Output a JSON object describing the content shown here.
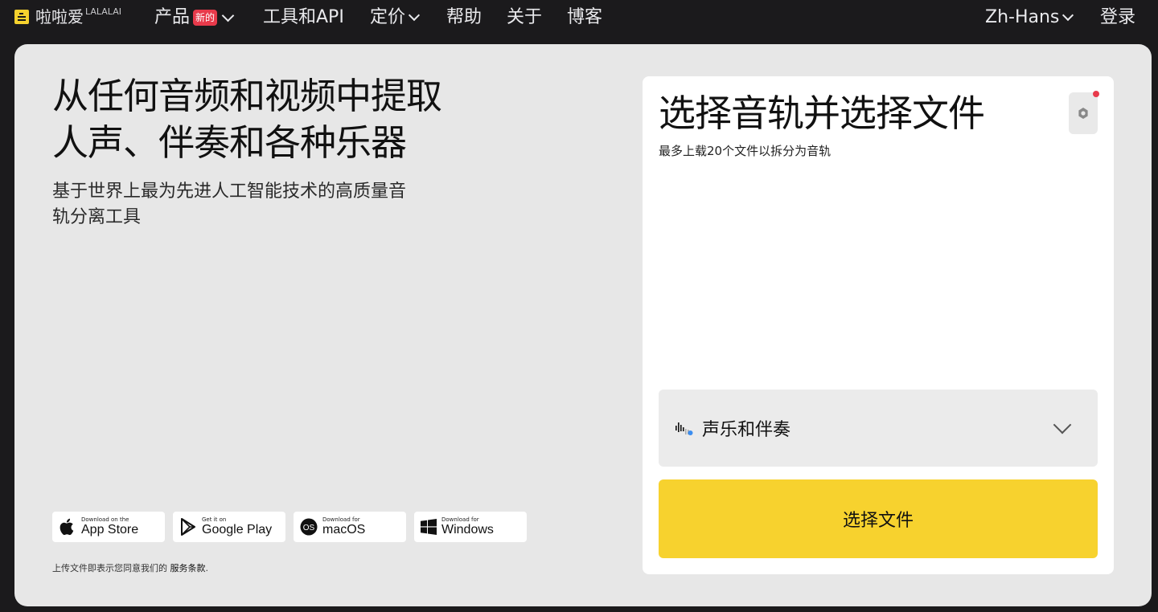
{
  "nav": {
    "logo_text": "啦啦爱",
    "logo_sup": "LALALAI",
    "products": "产品",
    "new_badge": "新的",
    "tools_api": "工具和API",
    "pricing": "定价",
    "help": "帮助",
    "about": "关于",
    "blog": "博客",
    "language": "Zh-Hans",
    "login": "登录"
  },
  "hero": {
    "title_line1": "从任何音频和视频中提取",
    "title_line2": "人声、伴奏和各种乐器",
    "subtitle_line1": "基于世界上最为先进人工智能技术的高质量音",
    "subtitle_line2": "轨分离工具"
  },
  "stores": [
    {
      "small": "Download on the",
      "big": "App Store",
      "icon": "apple-icon"
    },
    {
      "small": "Get it on",
      "big": "Google Play",
      "icon": "google-play-icon"
    },
    {
      "small": "Download for",
      "big": "macOS",
      "icon": "macos-icon"
    },
    {
      "small": "Download for",
      "big": "Windows",
      "icon": "windows-icon"
    }
  ],
  "terms": {
    "text": "上传文件即表示您同意我们的 ",
    "link": "服务条款",
    "end": "."
  },
  "upload": {
    "title": "选择音轨并选择文件",
    "subtitle": "最多上载20个文件以拆分为音轨",
    "stem_selected": "声乐和伴奏",
    "choose_button": "选择文件"
  },
  "colors": {
    "nav_bg": "#1b1a1c",
    "panel_bg": "#e7e7e7",
    "accent_yellow": "#f7d22e",
    "badge_red": "#e83a4b"
  }
}
